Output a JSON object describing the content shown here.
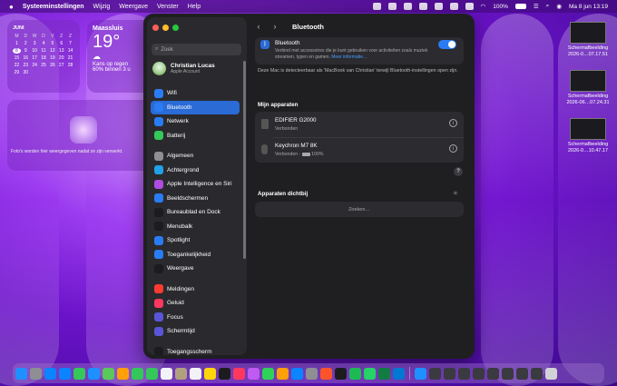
{
  "menubar": {
    "app_name": "Systeeminstellingen",
    "menus": [
      "Wijzig",
      "Weergave",
      "Venster",
      "Help"
    ],
    "battery": "100%",
    "datetime": "Ma 8 jun  13:19"
  },
  "widgets": {
    "calendar": {
      "month": "JUNI",
      "weekdays": [
        "M",
        "D",
        "W",
        "D",
        "V",
        "Z",
        "Z"
      ],
      "days": [
        "1",
        "2",
        "3",
        "4",
        "5",
        "6",
        "7",
        "8",
        "9",
        "10",
        "11",
        "12",
        "13",
        "14",
        "15",
        "16",
        "17",
        "18",
        "19",
        "20",
        "21",
        "22",
        "23",
        "24",
        "25",
        "26",
        "27",
        "28",
        "29",
        "30"
      ]
    },
    "weather": {
      "location": "Maassluis",
      "temperature": "19°",
      "forecast": "Kans op regen",
      "detail": "60% binnen 3 u"
    },
    "photos": {
      "message": "Foto's worden hier weergegeven nadat ze zijn verwerkt."
    }
  },
  "desktop_files": [
    {
      "name": "Schermafbeelding",
      "date": "2026-0…07.17.51"
    },
    {
      "name": "Schermafbeelding",
      "date": "2026-06…07.24.31"
    },
    {
      "name": "Schermafbeelding",
      "date": "2026-0…10.47.17"
    }
  ],
  "window": {
    "search_placeholder": "Zoek",
    "profile": {
      "name": "Christian Lucas",
      "subtitle": "Apple Account"
    },
    "sidebar_groups": [
      [
        {
          "label": "Wifi",
          "icon": "wifi-icon",
          "color": "#2a7cf5",
          "active": false
        },
        {
          "label": "Bluetooth",
          "icon": "bluetooth-icon",
          "color": "#2a7cf5",
          "active": true
        },
        {
          "label": "Netwerk",
          "icon": "globe-icon",
          "color": "#2a7cf5",
          "active": false
        },
        {
          "label": "Batterij",
          "icon": "battery-icon",
          "color": "#34c759",
          "active": false
        }
      ],
      [
        {
          "label": "Algemeen",
          "icon": "gear-icon",
          "color": "#8e8e93",
          "active": false
        },
        {
          "label": "Achtergrond",
          "icon": "wallpaper-icon",
          "color": "#22a0e8",
          "active": false
        },
        {
          "label": "Apple Intelligence en Siri",
          "icon": "siri-icon",
          "color": "#b04ce0",
          "active": false
        },
        {
          "label": "Beeldschermen",
          "icon": "display-icon",
          "color": "#2a7cf5",
          "active": false
        },
        {
          "label": "Bureaublad en Dock",
          "icon": "dock-icon",
          "color": "#1c1c1e",
          "active": false
        },
        {
          "label": "Menubalk",
          "icon": "menubar-icon",
          "color": "#1c1c1e",
          "active": false
        },
        {
          "label": "Spotlight",
          "icon": "search-icon",
          "color": "#2a7cf5",
          "active": false
        },
        {
          "label": "Toegankelijkheid",
          "icon": "accessibility-icon",
          "color": "#2a7cf5",
          "active": false
        },
        {
          "label": "Weergave",
          "icon": "appearance-icon",
          "color": "#1c1c1e",
          "active": false
        }
      ],
      [
        {
          "label": "Meldingen",
          "icon": "bell-icon",
          "color": "#ff3b30",
          "active": false
        },
        {
          "label": "Geluid",
          "icon": "speaker-icon",
          "color": "#ff375f",
          "active": false
        },
        {
          "label": "Focus",
          "icon": "moon-icon",
          "color": "#5856d6",
          "active": false
        },
        {
          "label": "Schermtijd",
          "icon": "hourglass-icon",
          "color": "#5856d6",
          "active": false
        }
      ],
      [
        {
          "label": "Toegangsscherm",
          "icon": "lock-icon",
          "color": "#1c1c1e",
          "active": false
        },
        {
          "label": "Privacy en beveiliging",
          "icon": "hand-icon",
          "color": "#2a7cf5",
          "active": false
        }
      ]
    ],
    "title": "Bluetooth",
    "bluetooth": {
      "label": "Bluetooth",
      "description": "Verbind met accessoires die je kunt gebruiken voor activiteiten zoals muziek streamen, typen en gamen.",
      "more_link": "Meer informatie…",
      "enabled": true
    },
    "discoverable_notice": "Deze Mac is detecteerbaar als 'MacBook van Christian' terwijl Bluetooth-instellingen open zijn.",
    "my_devices_header": "Mijn apparaten",
    "devices": [
      {
        "name": "EDIFIER G2000",
        "status": "Verbonden",
        "battery": ""
      },
      {
        "name": "Keychron M7 8K",
        "status": "Verbonden -",
        "battery": "100%"
      }
    ],
    "nearby_header": "Apparaten dichtbij",
    "nearby_status": "Zoeken…"
  },
  "dock": {
    "apps": [
      {
        "name": "Finder",
        "color": "#1e90ff"
      },
      {
        "name": "Launchpad",
        "color": "#8e8e93"
      },
      {
        "name": "App Store",
        "color": "#0a84ff"
      },
      {
        "name": "Safari",
        "color": "#0a84ff"
      },
      {
        "name": "Berichten",
        "color": "#34c759"
      },
      {
        "name": "Mail",
        "color": "#1e90ff"
      },
      {
        "name": "Kaarten",
        "color": "#5ac85a"
      },
      {
        "name": "Foto's",
        "color": "#ff9f0a"
      },
      {
        "name": "FaceTime",
        "color": "#34c759"
      },
      {
        "name": "Telefoon",
        "color": "#34c759"
      },
      {
        "name": "Agenda",
        "color": "#f2f2f7"
      },
      {
        "name": "Contacten",
        "color": "#b0a080"
      },
      {
        "name": "Herinneringen",
        "color": "#f2f2f7"
      },
      {
        "name": "Notities",
        "color": "#ffd60a"
      },
      {
        "name": "Apple TV",
        "color": "#1c1c1e"
      },
      {
        "name": "Muziek",
        "color": "#ff375f"
      },
      {
        "name": "Podcasts",
        "color": "#bf5af2"
      },
      {
        "name": "Numbers",
        "color": "#30d158"
      },
      {
        "name": "Pages",
        "color": "#ff9f0a"
      },
      {
        "name": "Keynote",
        "color": "#0a84ff"
      },
      {
        "name": "Systeeminstellingen",
        "color": "#8e8e93"
      },
      {
        "name": "Brave",
        "color": "#fb542b"
      },
      {
        "name": "ChatGPT",
        "color": "#1c1c1e"
      },
      {
        "name": "Spotify",
        "color": "#1db954"
      },
      {
        "name": "WhatsApp",
        "color": "#25d366"
      },
      {
        "name": "Excel",
        "color": "#107c41"
      },
      {
        "name": "Outlook",
        "color": "#0078d4"
      }
    ],
    "recent": [
      {
        "name": "Downloads",
        "color": "#1e90ff"
      },
      {
        "name": "Screenshot 1",
        "color": "#3a3a40"
      },
      {
        "name": "Screenshot 2",
        "color": "#3a3a40"
      },
      {
        "name": "Screenshot 3",
        "color": "#3a3a40"
      },
      {
        "name": "Screenshot 4",
        "color": "#3a3a40"
      },
      {
        "name": "Screenshot 5",
        "color": "#3a3a40"
      },
      {
        "name": "Screenshot 6",
        "color": "#3a3a40"
      },
      {
        "name": "Screenshot 7",
        "color": "#3a3a40"
      },
      {
        "name": "Screenshot 8",
        "color": "#3a3a40"
      },
      {
        "name": "Trash",
        "color": "#d1d1d6"
      }
    ]
  }
}
